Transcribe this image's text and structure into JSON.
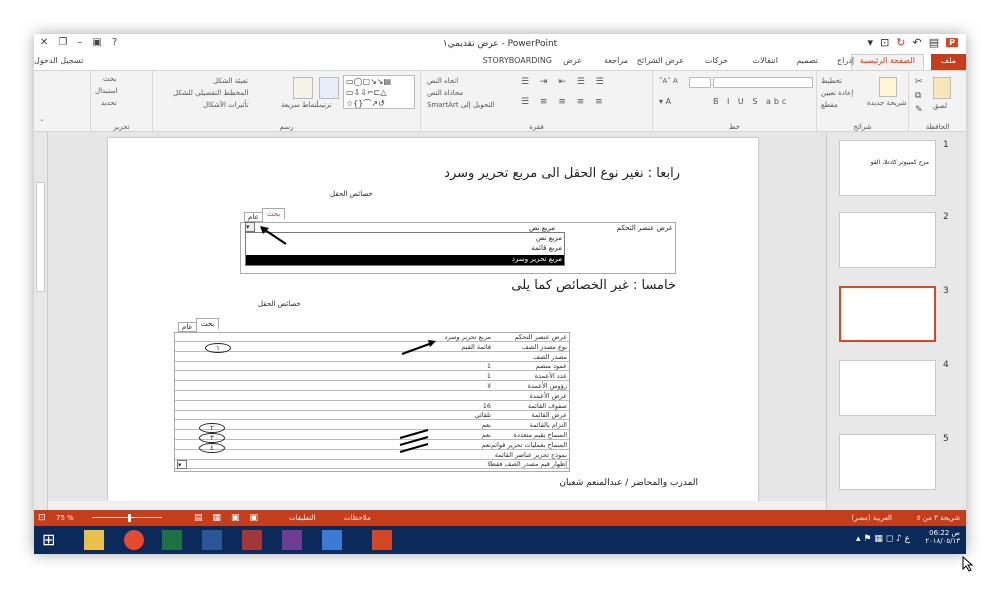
{
  "window": {
    "title": "عرض تقديمي١ - PowerPoint",
    "signin": "تسجيل الدخول"
  },
  "tabs": [
    "ملف",
    "الصفحة الرئيسية",
    "إدراج",
    "تصميم",
    "انتقالات",
    "حركات",
    "عرض الشرائح",
    "مراجعة",
    "عرض",
    "STORYBOARDING"
  ],
  "ribbon": {
    "groups": {
      "clipboard": "الحافظة",
      "slides": "شرائح",
      "font": "خط",
      "paragraph": "فقرة",
      "drawing": "رسم",
      "editing": "تحرير"
    },
    "clipboard": {
      "paste": "لصق"
    },
    "slides": {
      "new_slide": "شريحة جديدة",
      "layout": "تخطيط",
      "reset": "إعادة تعيين",
      "section": "مقطع"
    },
    "paragraph": {
      "text_direction": "اتجاه النص",
      "align_text": "محاذاة النص",
      "smartart": "التحويل إلى SmartArt"
    },
    "drawing": {
      "arrange": "ترتيب",
      "quick_styles": "أنماط سريعة",
      "fill": "تعبئة الشكل",
      "outline": "المخطط التفصيلي للشكل",
      "effects": "تأثيرات الأشكال"
    },
    "editing": {
      "find": "بحث",
      "replace": "استبدال",
      "select": "تحديد"
    }
  },
  "slide": {
    "heading4": "رابعا : نغير نوع الحقل الى مربع تحرير وسرد",
    "heading5": "خامسا : غير الخصائص كما يلى",
    "footer": "المدرب والمحاضر / عبدالمنعم شعبان",
    "panel1": {
      "title": "خصائص الحقل",
      "tab_general": "عام",
      "tab_lookup": "بحث",
      "row_label": "عرض عنصر التحكم",
      "row_value": "مربع نص",
      "options": [
        "مربع نص",
        "مربع قائمة",
        "مربع تحرير وسرد"
      ]
    },
    "panel2": {
      "title": "خصائص الحقل",
      "tab_general": "عام",
      "tab_lookup": "بحث",
      "rows": [
        {
          "n": "عرض عنصر التحكم",
          "v": "مربع تحرير وسرد"
        },
        {
          "n": "نوع مصدر الصف",
          "v": "قائمة القيم"
        },
        {
          "n": "مصدر الصف",
          "v": ""
        },
        {
          "n": "عمود منضم",
          "v": "1"
        },
        {
          "n": "عدد الأعمدة",
          "v": "1"
        },
        {
          "n": "رؤوس الأعمدة",
          "v": "لا"
        },
        {
          "n": "عرض الأعمدة",
          "v": ""
        },
        {
          "n": "صفوف القائمة",
          "v": "16"
        },
        {
          "n": "عرض القائمة",
          "v": "تلقائي"
        },
        {
          "n": "التزام بالقائمة",
          "v": "نعم"
        },
        {
          "n": "السماح بقيم متعددة",
          "v": "نعم"
        },
        {
          "n": "السماح بعمليات تحرير قوائم",
          "v": "نعم"
        },
        {
          "n": "نموذج تحرير عناصر القائمة",
          "v": ""
        },
        {
          "n": "إظهار قيم مصدر الصف فقط",
          "v": "لا"
        }
      ],
      "marks": [
        "١",
        "٢",
        "٣",
        "٤"
      ]
    }
  },
  "thumbs": {
    "numbers": [
      "1",
      "2",
      "3",
      "4",
      "5"
    ],
    "t1_title": "مزج كمبيوتر كادتلا، القو"
  },
  "status": {
    "slide": "شريحة ٣ من ٥",
    "lang": "العربية (مصر)",
    "notes": "ملاحظات",
    "comments": "التعليقات",
    "zoom": "75 %"
  },
  "taskbar": {
    "time": "06:22 ص",
    "date": "٢٠١٨/٠٥/١٣"
  }
}
